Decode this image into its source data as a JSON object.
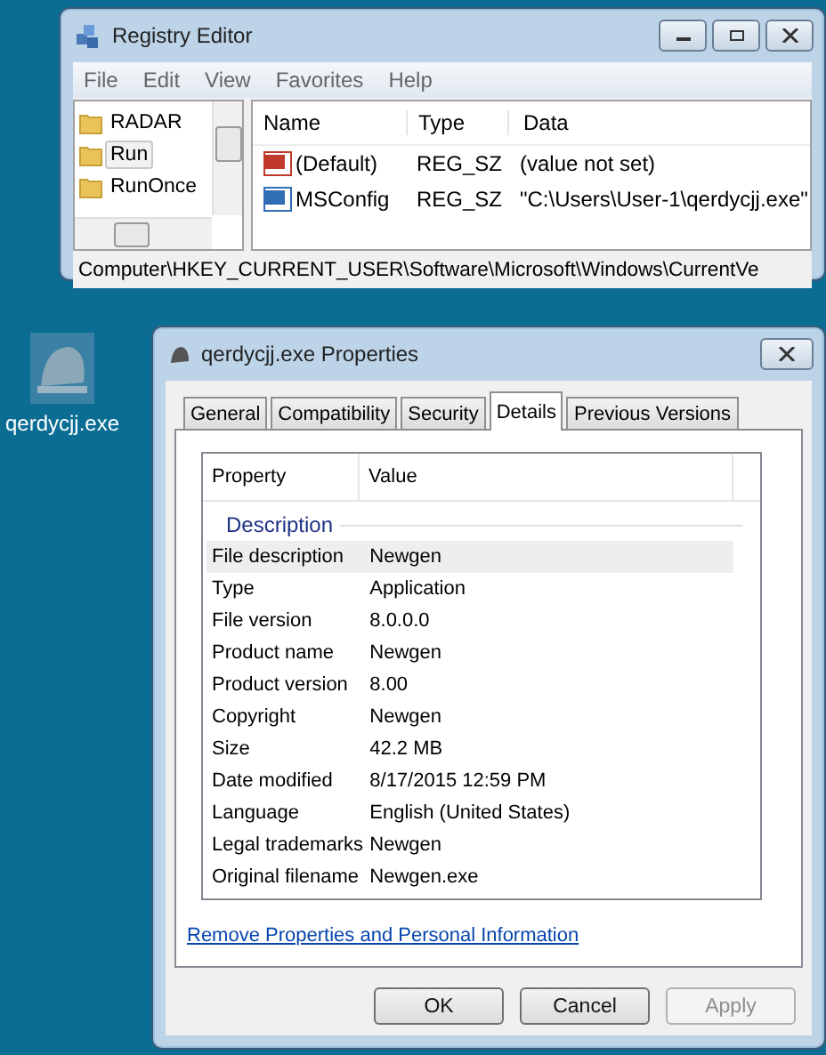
{
  "registry_editor": {
    "title": "Registry Editor",
    "menu": [
      "File",
      "Edit",
      "View",
      "Favorites",
      "Help"
    ],
    "tree": [
      {
        "label": "RADAR",
        "selected": false
      },
      {
        "label": "Run",
        "selected": true
      },
      {
        "label": "RunOnce",
        "selected": false
      }
    ],
    "columns": [
      "Name",
      "Type",
      "Data"
    ],
    "values": [
      {
        "kind": "default",
        "name": "(Default)",
        "type": "REG_SZ",
        "data": "(value not set)"
      },
      {
        "kind": "string",
        "name": "MSConfig",
        "type": "REG_SZ",
        "data": "\"C:\\Users\\User-1\\qerdycjj.exe\""
      }
    ],
    "status_bar": "Computer\\HKEY_CURRENT_USER\\Software\\Microsoft\\Windows\\CurrentVe"
  },
  "desktop_icon": {
    "label": "qerdycjj.exe"
  },
  "properties": {
    "title": "qerdycjj.exe Properties",
    "tabs": [
      {
        "label": "General",
        "selected": false
      },
      {
        "label": "Compatibility",
        "selected": false
      },
      {
        "label": "Security",
        "selected": false
      },
      {
        "label": "Details",
        "selected": true
      },
      {
        "label": "Previous Versions",
        "selected": false
      }
    ],
    "columns": [
      "Property",
      "Value"
    ],
    "group": "Description",
    "rows": [
      {
        "property": "File description",
        "value": "Newgen",
        "selected": true
      },
      {
        "property": "Type",
        "value": "Application",
        "selected": false
      },
      {
        "property": "File version",
        "value": "8.0.0.0",
        "selected": false
      },
      {
        "property": "Product name",
        "value": "Newgen",
        "selected": false
      },
      {
        "property": "Product version",
        "value": "8.00",
        "selected": false
      },
      {
        "property": "Copyright",
        "value": "Newgen",
        "selected": false
      },
      {
        "property": "Size",
        "value": "42.2 MB",
        "selected": false
      },
      {
        "property": "Date modified",
        "value": "8/17/2015 12:59 PM",
        "selected": false
      },
      {
        "property": "Language",
        "value": "English (United States)",
        "selected": false
      },
      {
        "property": "Legal trademarks",
        "value": "Newgen",
        "selected": false
      },
      {
        "property": "Original filename",
        "value": "Newgen.exe",
        "selected": false
      }
    ],
    "link": "Remove Properties and Personal Information",
    "buttons": [
      {
        "label": "OK",
        "disabled": false
      },
      {
        "label": "Cancel",
        "disabled": false
      },
      {
        "label": "Apply",
        "disabled": true
      }
    ]
  }
}
